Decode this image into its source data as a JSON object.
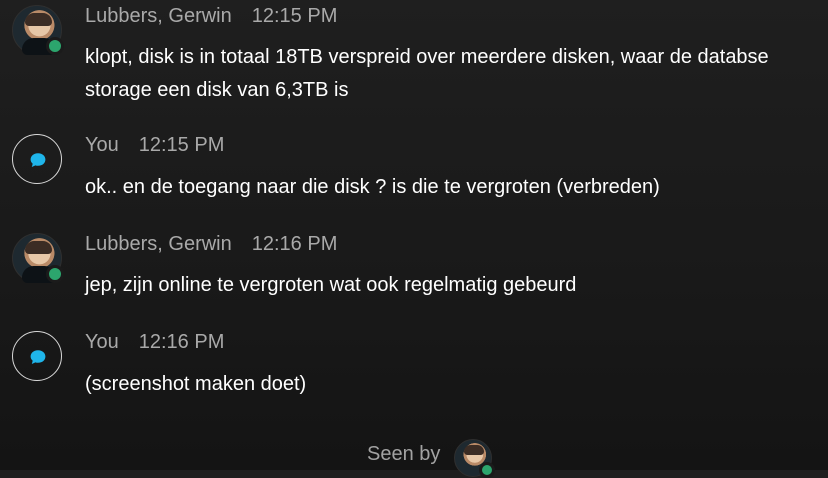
{
  "messages": [
    {
      "sender": "Lubbers, Gerwin",
      "time": "12:15 PM",
      "text": "klopt, disk is in totaal 18TB verspreid over meerdere disken, waar de databse storage een disk van 6,3TB is",
      "avatar": "profile-photo-avatar",
      "presence_status": "online",
      "presence_color": "#2ca56d"
    },
    {
      "sender": "You",
      "time": "12:15 PM",
      "text": "ok.. en de toegang naar die disk ? is die te vergroten (verbreden)",
      "avatar": "chat-bubble-icon",
      "icon_color": "#1fb5ea"
    },
    {
      "sender": "Lubbers, Gerwin",
      "time": "12:16 PM",
      "text": "jep, zijn online te vergroten wat ook regelmatig gebeurd",
      "avatar": "profile-photo-avatar",
      "presence_status": "online",
      "presence_color": "#2ca56d"
    },
    {
      "sender": "You",
      "time": "12:16 PM",
      "text": "(screenshot maken doet)",
      "avatar": "chat-bubble-icon",
      "icon_color": "#1fb5ea"
    }
  ],
  "seen_by": {
    "label": "Seen by",
    "avatar": "profile-photo-avatar",
    "presence_status": "online"
  }
}
